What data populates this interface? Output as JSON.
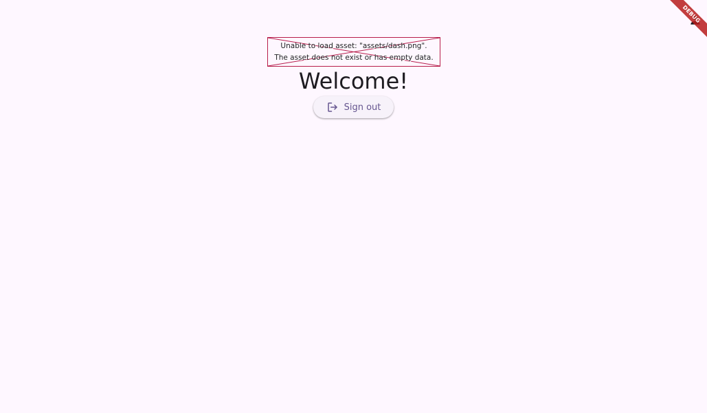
{
  "header": {
    "account_icon": "person-icon"
  },
  "debug_banner": {
    "label": "DEBUG",
    "color": "#b71c1c"
  },
  "image_error": {
    "line1": "Unable to load asset: \"assets/dash.png\".",
    "line2": "The asset does not exist or has empty data.",
    "border_color": "#b71c4a"
  },
  "main": {
    "title": "Welcome!",
    "sign_out_label": "Sign out",
    "sign_out_icon": "logout-icon",
    "accent_color": "#65558f"
  },
  "background_color": "#fef7ff"
}
